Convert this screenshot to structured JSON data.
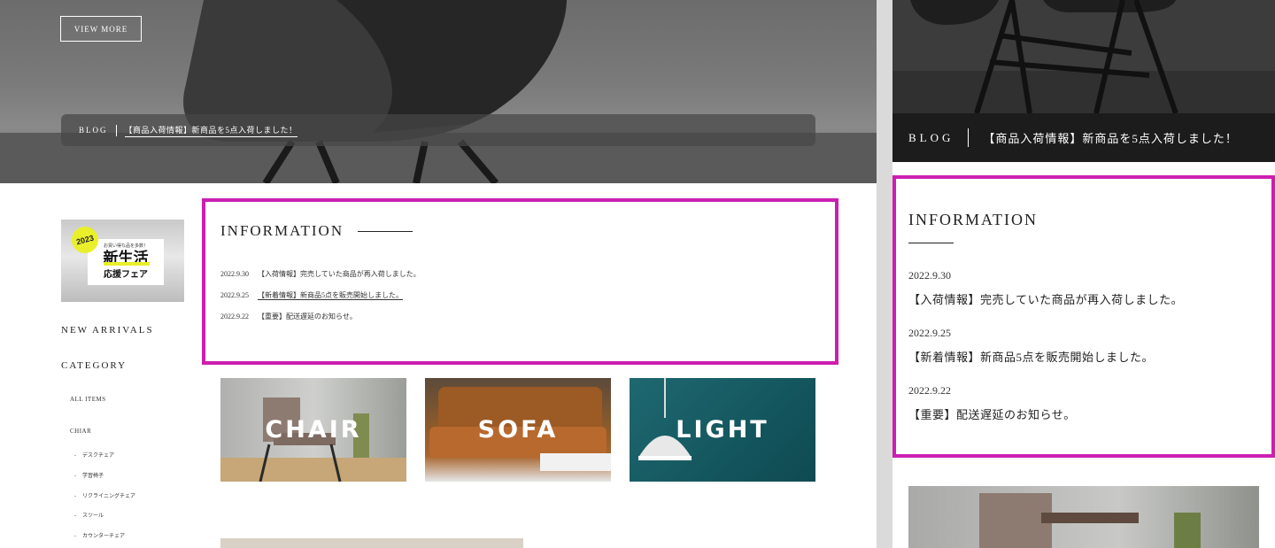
{
  "desktop": {
    "hero": {
      "view_more_label": "VIEW MORE",
      "blog_label": "BLOG",
      "blog_link": "【商品入荷情報】新商品を5点入荷しました！"
    },
    "banner": {
      "badge": "2023",
      "small_text": "お買い得な品を多数！",
      "big_text": "新生活",
      "mid_text": "応援フェア"
    },
    "sidebar": {
      "new_arrivals": "NEW ARRIVALS",
      "category": "CATEGORY",
      "all_items": "ALL ITEMS",
      "chair_group": "CHIAR",
      "sub_items": [
        "デスクチェア",
        "学習椅子",
        "リクライニングチェア",
        "スツール",
        "カウンターチェア"
      ]
    },
    "information": {
      "title": "INFORMATION",
      "items": [
        {
          "date": "2022.9.30",
          "text": "【入荷情報】完売していた商品が再入荷しました。"
        },
        {
          "date": "2022.9.25",
          "text": "【新着情報】新商品5点を販売開始しました。"
        },
        {
          "date": "2022.9.22",
          "text": "【重要】配送遅延のお知らせ。"
        }
      ]
    },
    "categories": [
      {
        "label": "CHAIR"
      },
      {
        "label": "SOFA"
      },
      {
        "label": "LIGHT"
      }
    ]
  },
  "mobile": {
    "blog_label": "BLOG",
    "blog_link": "【商品入荷情報】新商品を5点入荷しました！",
    "information": {
      "title": "INFORMATION",
      "items": [
        {
          "date": "2022.9.30",
          "text": "【入荷情報】完売していた商品が再入荷しました。"
        },
        {
          "date": "2022.9.25",
          "text": "【新着情報】新商品5点を販売開始しました。"
        },
        {
          "date": "2022.9.22",
          "text": "【重要】配送遅延のお知らせ。"
        }
      ]
    }
  },
  "colors": {
    "highlight": "#cc1fb1",
    "banner_yellow": "#e9f02b",
    "light_tile": "#1f6870",
    "mobile_blog_bar": "#1c1c1c"
  }
}
